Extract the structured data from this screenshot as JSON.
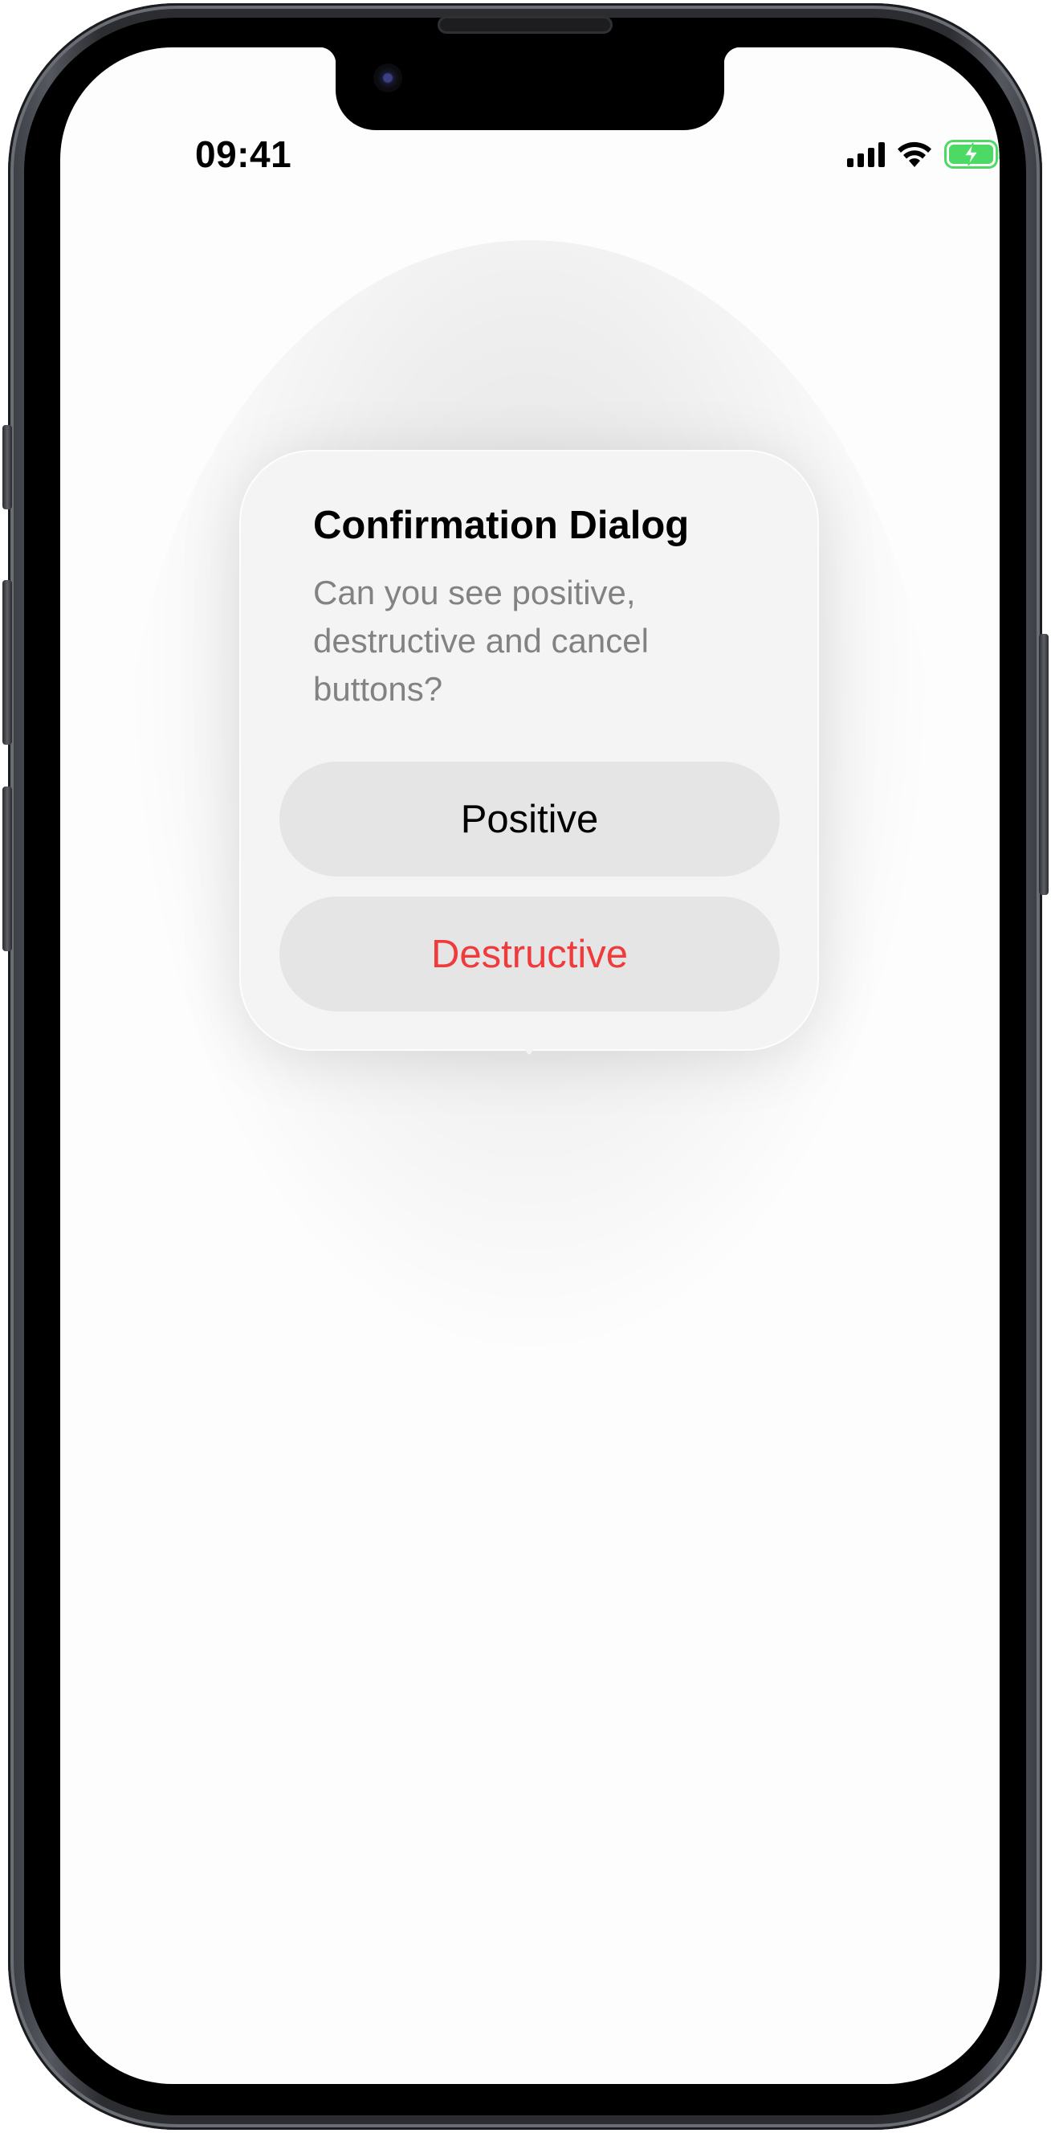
{
  "status_bar": {
    "time": "09:41",
    "icons": [
      "cellular-signal-icon",
      "wifi-icon",
      "battery-charging-icon"
    ]
  },
  "dialog": {
    "title": "Confirmation Dialog",
    "message": "Can you see positive, destructive and cancel buttons?",
    "buttons": [
      {
        "label": "Positive",
        "role": "positive"
      },
      {
        "label": "Destructive",
        "role": "destructive"
      }
    ]
  },
  "colors": {
    "destructive": "#ef3b3b",
    "button_background": "#e5e5e5",
    "dialog_background": "#f4f4f4",
    "message_text": "#828282",
    "battery_green": "#4cd964"
  }
}
